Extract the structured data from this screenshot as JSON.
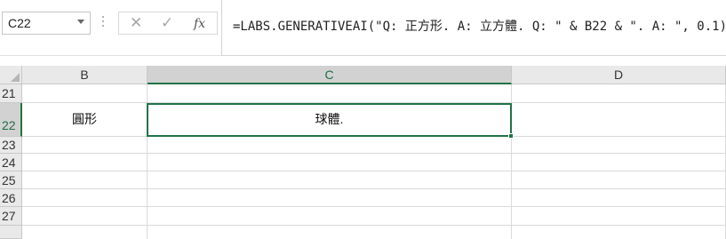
{
  "name_box": {
    "value": "C22"
  },
  "formula_bar": {
    "cancel_icon": "✕",
    "enter_icon": "✓",
    "fx_label": "fx",
    "formula": "=LABS.GENERATIVEAI(\"Q: 正方形. A: 立方體. Q: \" & B22 & \". A: \", 0.1)"
  },
  "columns": [
    "B",
    "C",
    "D"
  ],
  "rows": [
    "21",
    "22",
    "23",
    "24",
    "25",
    "26",
    "27"
  ],
  "cells": {
    "B22": "圓形",
    "C22": "球體."
  },
  "selection": {
    "active_cell": "C22",
    "accent_color": "#217346"
  }
}
